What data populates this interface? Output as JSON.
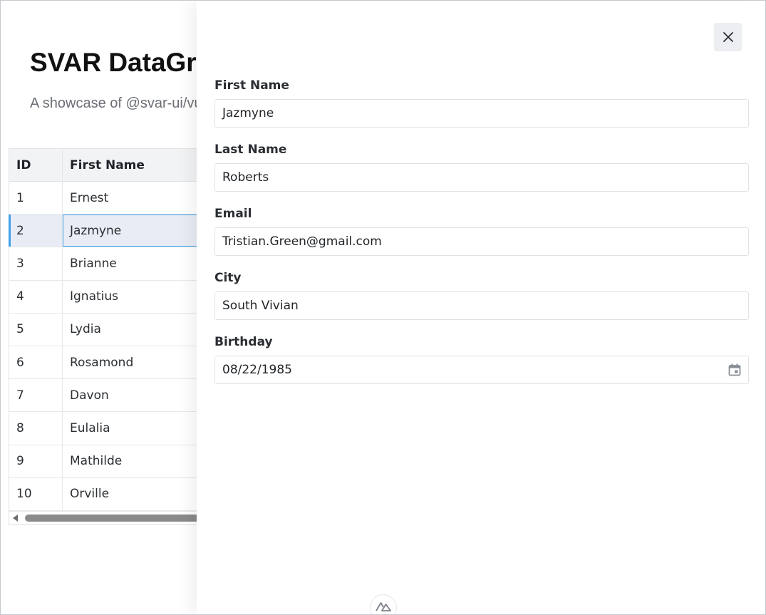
{
  "page": {
    "title": "SVAR DataGrid",
    "subtitle": "A showcase of @svar-ui/vue-grid"
  },
  "grid": {
    "columns": [
      "ID",
      "First Name"
    ],
    "rows": [
      {
        "id": "1",
        "first_name": "Ernest"
      },
      {
        "id": "2",
        "first_name": "Jazmyne"
      },
      {
        "id": "3",
        "first_name": "Brianne"
      },
      {
        "id": "4",
        "first_name": "Ignatius"
      },
      {
        "id": "5",
        "first_name": "Lydia"
      },
      {
        "id": "6",
        "first_name": "Rosamond"
      },
      {
        "id": "7",
        "first_name": "Davon"
      },
      {
        "id": "8",
        "first_name": "Eulalia"
      },
      {
        "id": "9",
        "first_name": "Mathilde"
      },
      {
        "id": "10",
        "first_name": "Orville"
      }
    ],
    "selected_row_id": "2"
  },
  "editor": {
    "close_icon": "close-icon",
    "fields": {
      "first_name": {
        "label": "First Name",
        "value": "Jazmyne"
      },
      "last_name": {
        "label": "Last Name",
        "value": "Roberts"
      },
      "email": {
        "label": "Email",
        "value": "Tristian.Green@gmail.com"
      },
      "city": {
        "label": "City",
        "value": "South Vivian"
      },
      "birthday": {
        "label": "Birthday",
        "value": "08/22/1985",
        "icon": "calendar-icon"
      }
    }
  },
  "colors": {
    "accent": "#3fa0e6",
    "selected_row_bg": "#e9ecf5",
    "header_bg": "#f2f3f5",
    "nuxt_green": "#00dc82"
  }
}
